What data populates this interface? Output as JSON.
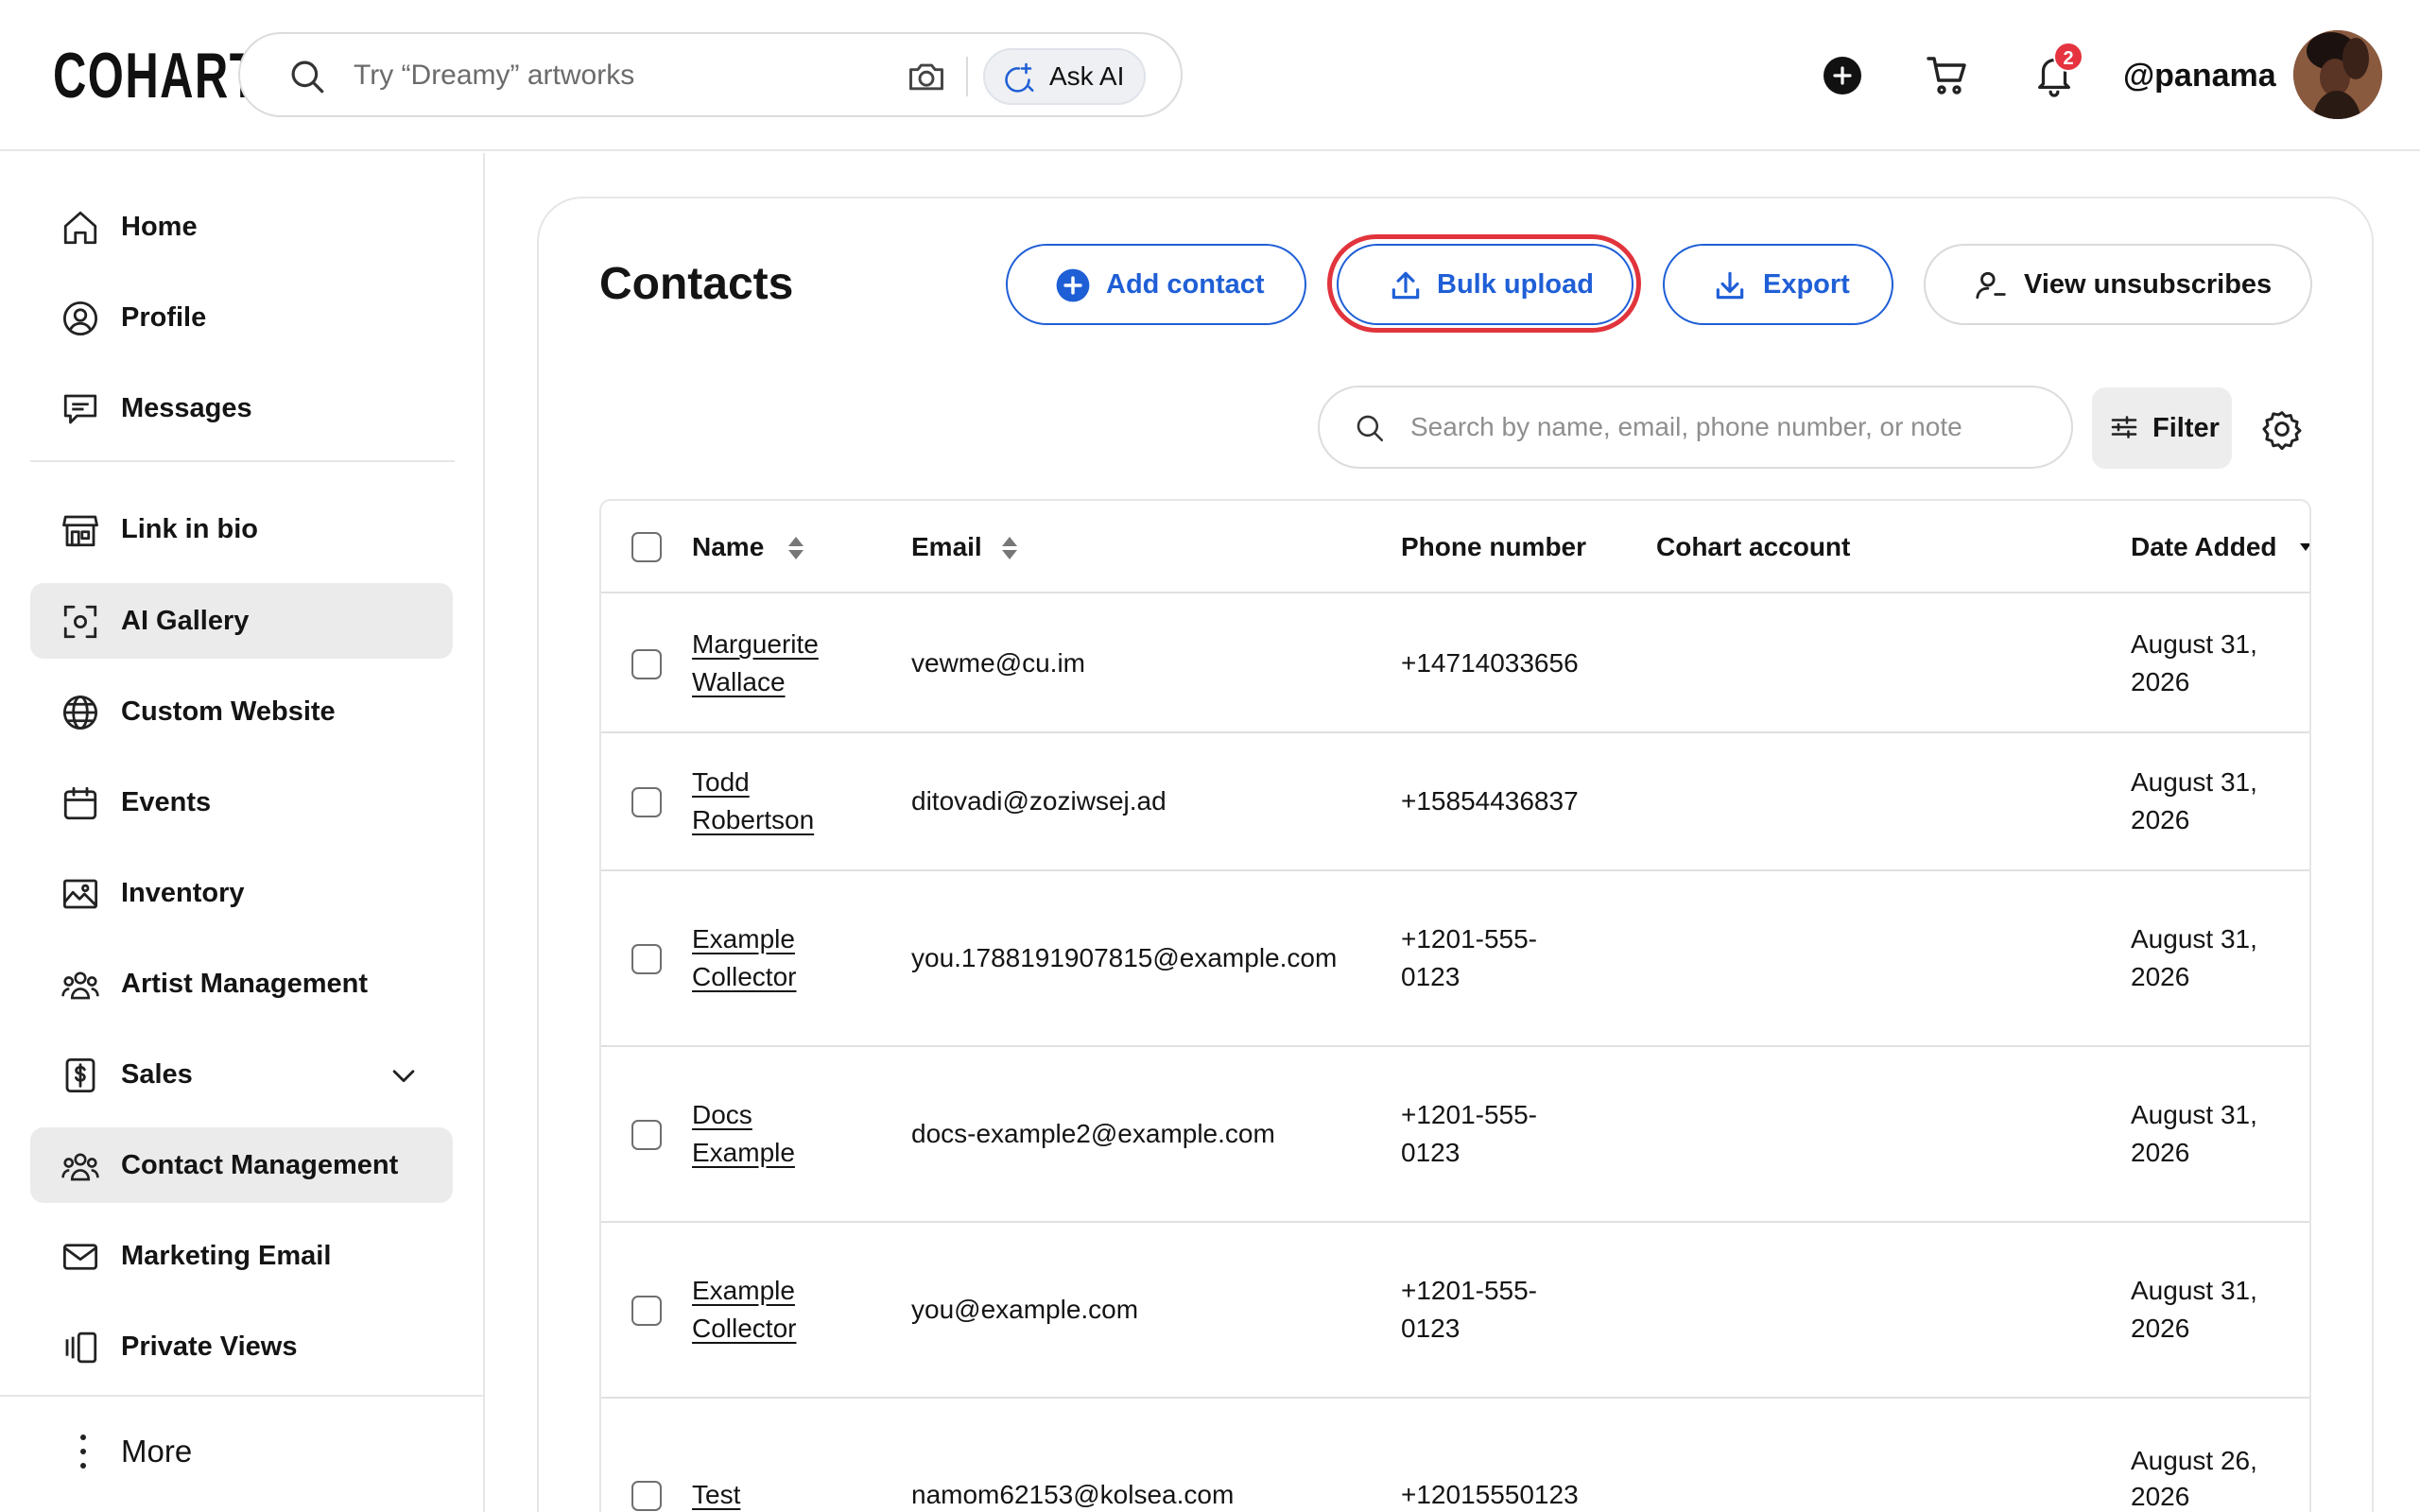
{
  "header": {
    "logo": "COHART",
    "search_placeholder": "Try “Dreamy” artworks",
    "ask_ai_label": "Ask AI",
    "notification_count": "2",
    "username": "@panama"
  },
  "sidebar": {
    "items": [
      {
        "label": "Home",
        "icon": "home-icon"
      },
      {
        "label": "Profile",
        "icon": "profile-icon"
      },
      {
        "label": "Messages",
        "icon": "messages-icon"
      },
      {
        "label": "Link in bio",
        "icon": "storefront-icon"
      },
      {
        "label": "AI Gallery",
        "icon": "scan-icon"
      },
      {
        "label": "Custom Website",
        "icon": "globe-icon"
      },
      {
        "label": "Events",
        "icon": "calendar-icon"
      },
      {
        "label": "Inventory",
        "icon": "image-icon"
      },
      {
        "label": "Artist Management",
        "icon": "users-icon"
      },
      {
        "label": "Sales",
        "icon": "dollar-icon"
      },
      {
        "label": "Contact Management",
        "icon": "users-icon"
      },
      {
        "label": "Marketing Email",
        "icon": "mail-icon"
      },
      {
        "label": "Private Views",
        "icon": "views-icon"
      }
    ],
    "more_label": "More"
  },
  "main": {
    "title": "Contacts",
    "buttons": {
      "add_contact": "Add contact",
      "bulk_upload": "Bulk upload",
      "export": "Export",
      "view_unsubscribes": "View unsubscribes"
    },
    "search_placeholder": "Search by name, email, phone number, or note",
    "filter_label": "Filter",
    "columns": {
      "name": "Name",
      "email": "Email",
      "phone": "Phone number",
      "cohart": "Cohart account",
      "date": "Date Added"
    },
    "rows": [
      {
        "name1": "Marguerite",
        "name2": "Wallace",
        "email": "vewme@cu.im",
        "phone1": "+14714033656",
        "phone2": "",
        "date1": "August 31,",
        "date2": "2026"
      },
      {
        "name1": "Todd",
        "name2": "Robertson",
        "email": "ditovadi@zoziwsej.ad",
        "phone1": "+15854436837",
        "phone2": "",
        "date1": "August 31,",
        "date2": "2026"
      },
      {
        "name1": "Example",
        "name2": "Collector",
        "email": "you.1788191907815@example.com",
        "phone1": "+1201-555-",
        "phone2": "0123",
        "date1": "August 31,",
        "date2": "2026"
      },
      {
        "name1": "Docs",
        "name2": "Example",
        "email": "docs-example2@example.com",
        "phone1": "+1201-555-",
        "phone2": "0123",
        "date1": "August 31,",
        "date2": "2026"
      },
      {
        "name1": "Example",
        "name2": "Collector",
        "email": "you@example.com",
        "phone1": "+1201-555-",
        "phone2": "0123",
        "date1": "August 31,",
        "date2": "2026"
      },
      {
        "name1": "Test",
        "name2": "",
        "email": "namom62153@kolsea.com",
        "phone1": "+12015550123",
        "phone2": "",
        "date1": "August 26,",
        "date2": "2026"
      }
    ]
  },
  "colors": {
    "accent": "#1f5fd6",
    "highlight_ring": "#e1343d",
    "badge": "#e5343f",
    "active_nav": "#ebebeb"
  }
}
